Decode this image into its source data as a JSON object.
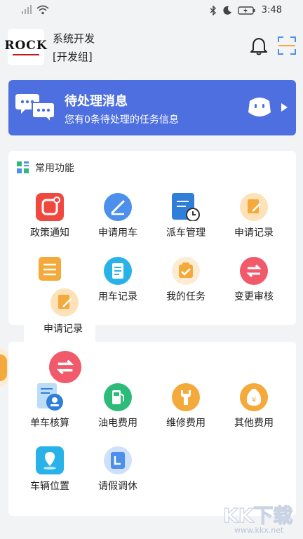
{
  "status_bar": {
    "time": "3:48"
  },
  "header": {
    "logo_text": "ROCK",
    "company": "系统开发",
    "group": "[开发组]"
  },
  "banner": {
    "title": "待处理消息",
    "subtitle": "您有0条待处理的任务信息"
  },
  "section": {
    "title": "常用功能"
  },
  "items_row1": [
    {
      "label": "政策通知",
      "icon": "policy-icon",
      "color": "#f0483e"
    },
    {
      "label": "申请用车",
      "icon": "apply-car-icon",
      "color": "#4c8fec"
    },
    {
      "label": "派车管理",
      "icon": "dispatch-icon",
      "color": "#2f7fd9"
    },
    {
      "label": "申请记录",
      "icon": "apply-record-icon",
      "color": "#f4a93b"
    }
  ],
  "items_row2": [
    {
      "label": "",
      "icon": "doc-icon",
      "color": "#f4a93b"
    },
    {
      "label": "用车记录",
      "icon": "car-record-icon",
      "color": "#29b2e8"
    },
    {
      "label": "我的任务",
      "icon": "task-icon",
      "color": "#f4a93b"
    },
    {
      "label": "变更审核",
      "icon": "change-review-icon",
      "color": "#f05a6a"
    }
  ],
  "drag_overlay": {
    "label": "申请记录"
  },
  "items_row3": [
    {
      "label": "单车核算",
      "icon": "accounting-icon",
      "color": "#2f7fd9"
    },
    {
      "label": "油电费用",
      "icon": "fuel-icon",
      "color": "#2dbb7a"
    },
    {
      "label": "维修费用",
      "icon": "repair-icon",
      "color": "#f4a93b"
    },
    {
      "label": "其他费用",
      "icon": "other-fee-icon",
      "color": "#f4a93b"
    }
  ],
  "items_row4": [
    {
      "label": "车辆位置",
      "icon": "location-icon",
      "color": "#29b2e8"
    },
    {
      "label": "请假调休",
      "icon": "leave-icon",
      "color": "#4c8fec"
    }
  ],
  "watermark": "KK下载",
  "watermark_url": "www.kkx.net"
}
